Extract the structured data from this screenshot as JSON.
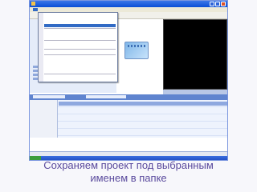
{
  "caption": {
    "line1": "Сохраняем проект под выбранным",
    "line2": "именем в папке"
  },
  "window": {
    "icon": "movie-maker-icon",
    "controls": [
      "minimize-icon",
      "maximize-icon",
      "close-icon"
    ]
  },
  "colors": {
    "caption_text": "#5a4a9d",
    "titlebar": "#0a4fd6",
    "menu_highlight": "#316ac5",
    "storyboard": "#5f84cf"
  }
}
